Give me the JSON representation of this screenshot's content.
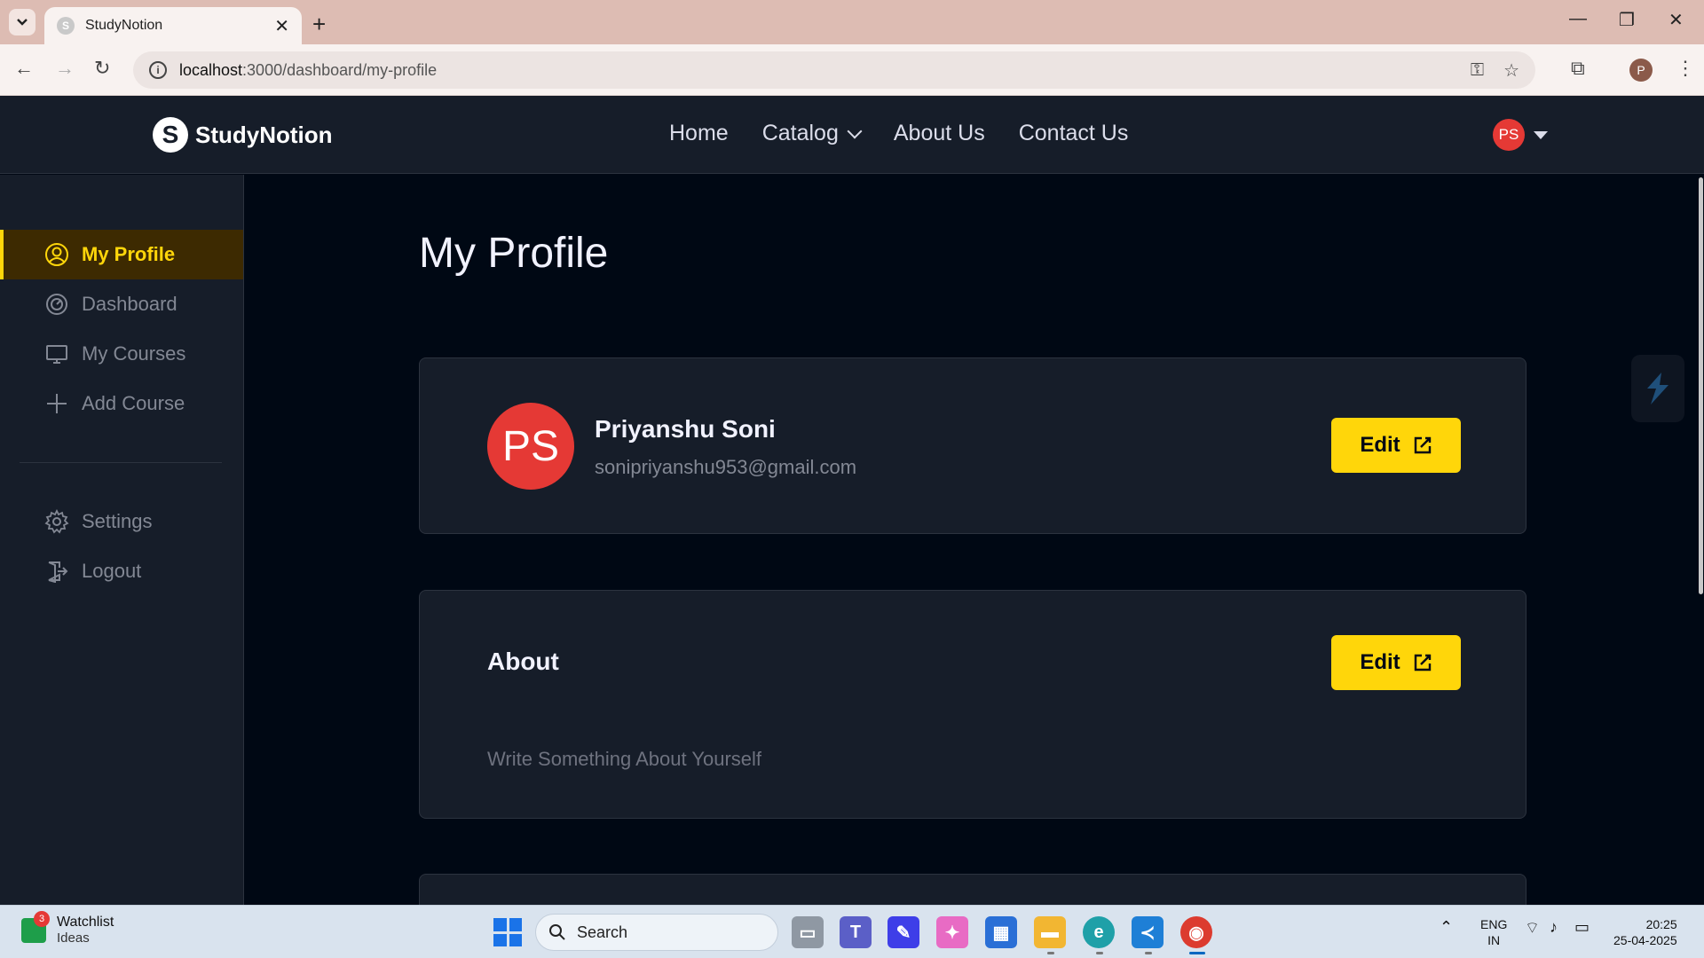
{
  "browser": {
    "tab_title": "StudyNotion",
    "tab_favicon": "S",
    "url_host": "localhost",
    "url_rest": ":3000/dashboard/my-profile",
    "profile_initial": "P"
  },
  "navbar": {
    "logo_text": "StudyNotion",
    "logo_mark": "S",
    "links": [
      "Home",
      "Catalog",
      "About Us",
      "Contact Us"
    ],
    "user_initials": "PS"
  },
  "sidebar": {
    "items": [
      {
        "label": "My Profile",
        "icon": "user-circle-icon",
        "active": true
      },
      {
        "label": "Dashboard",
        "icon": "dashboard-gauge-icon"
      },
      {
        "label": "My Courses",
        "icon": "monitor-icon"
      },
      {
        "label": "Add Course",
        "icon": "plus-icon"
      }
    ],
    "bottom_items": [
      {
        "label": "Settings",
        "icon": "gear-icon"
      },
      {
        "label": "Logout",
        "icon": "logout-icon"
      }
    ]
  },
  "main": {
    "title": "My Profile",
    "profile": {
      "initials": "PS",
      "name": "Priyanshu Soni",
      "email": "sonipriyanshu953@gmail.com",
      "edit_label": "Edit"
    },
    "about": {
      "title": "About",
      "placeholder": "Write Something About Yourself",
      "edit_label": "Edit"
    }
  },
  "taskbar": {
    "widget_title": "Watchlist",
    "widget_sub": "Ideas",
    "widget_badge": "3",
    "search_label": "Search",
    "lang_1": "ENG",
    "lang_2": "IN",
    "time": "20:25",
    "date": "25-04-2025"
  },
  "colors": {
    "accent": "#FFD60A",
    "bg": "#000814",
    "panel": "#161D29",
    "avatar": "#E53935"
  }
}
